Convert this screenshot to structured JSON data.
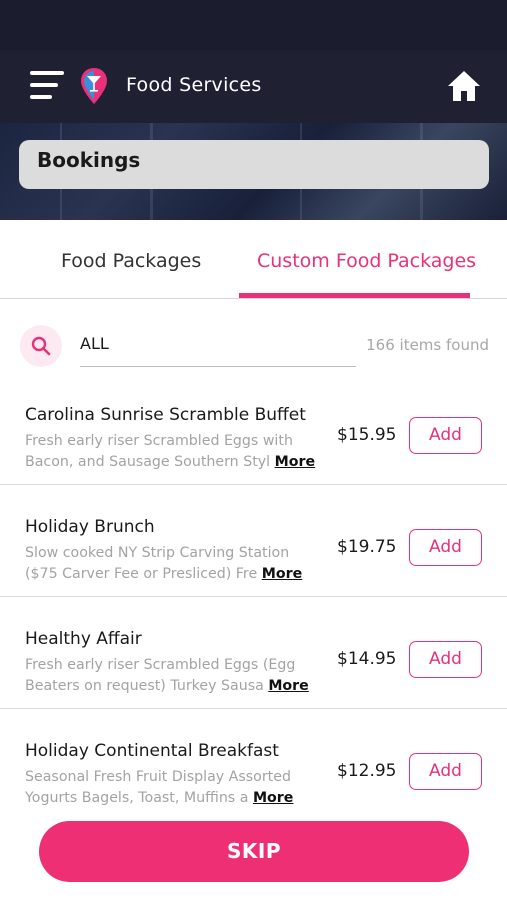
{
  "header": {
    "title": "Food Services",
    "menu_icon": "hamburger-menu-icon",
    "logo_icon": "cocktail-pin-logo-icon",
    "home_icon": "home-icon"
  },
  "banner": {
    "field_text": "Bookings"
  },
  "tabs": [
    {
      "label": "Food Packages",
      "active": false
    },
    {
      "label": "Custom Food Packages",
      "active": true
    }
  ],
  "search": {
    "value": "ALL",
    "icon": "search-icon",
    "items_found": "166 items found"
  },
  "items": [
    {
      "name": "Carolina Sunrise Scramble Buffet",
      "desc_line1": "Fresh early riser Scrambled Eggs with",
      "desc_line2": "Bacon, and Sausage Southern Styl",
      "more": "More",
      "price": "$15.95",
      "add": "Add"
    },
    {
      "name": "Holiday Brunch",
      "desc_line1": "Slow cooked NY Strip Carving Station",
      "desc_line2": "($75 Carver Fee or Presliced) Fre",
      "more": "More",
      "price": "$19.75",
      "add": "Add"
    },
    {
      "name": "Healthy Affair",
      "desc_line1": "Fresh early riser Scrambled Eggs (Egg",
      "desc_line2": "Beaters on request) Turkey Sausa",
      "more": "More",
      "price": "$14.95",
      "add": "Add"
    },
    {
      "name": "Holiday Continental Breakfast",
      "desc_line1": "Seasonal Fresh Fruit Display Assorted",
      "desc_line2": "Yogurts Bagels, Toast, Muffins a",
      "more": "More",
      "price": "$12.95",
      "add": "Add"
    }
  ],
  "footer": {
    "skip_label": "SKIP"
  },
  "colors": {
    "accent": "#e9317a",
    "header_bg": "#1f2133",
    "skip_bg": "#ef2f73"
  }
}
